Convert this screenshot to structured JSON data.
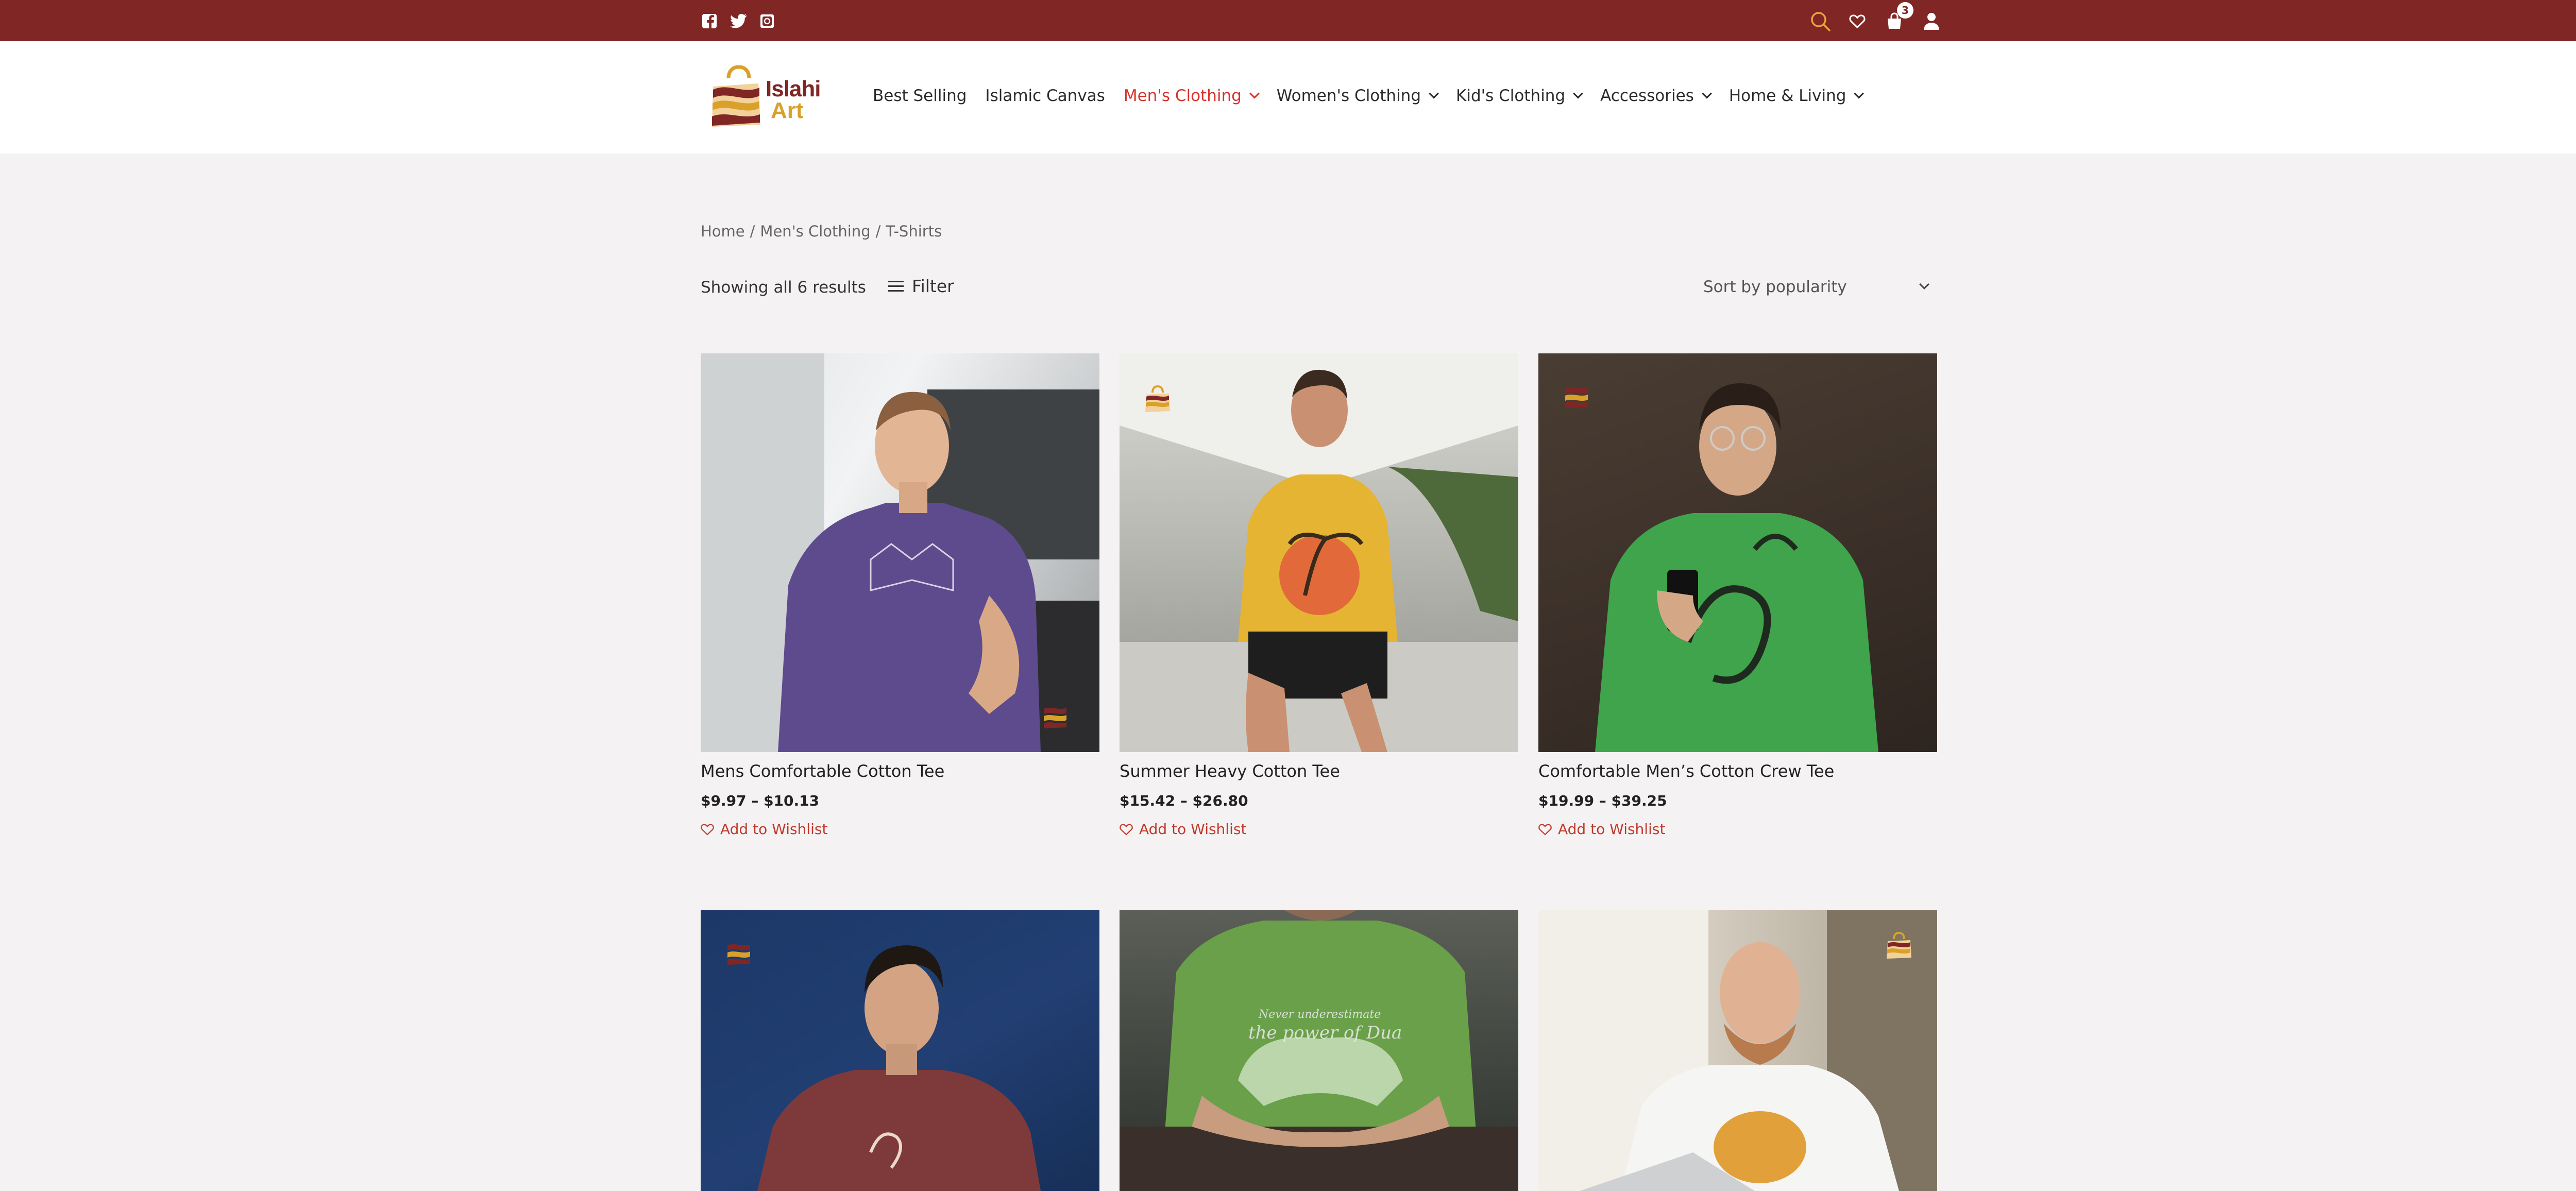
{
  "topbar": {
    "social": [
      "facebook-icon",
      "twitter-icon",
      "instagram-icon"
    ],
    "icons": [
      "search-icon",
      "heart-icon",
      "cart-icon",
      "user-icon"
    ],
    "cart_count": "3",
    "bg_color": "#802624"
  },
  "logo": {
    "line1": "Islahi",
    "line2": "Art"
  },
  "nav": [
    {
      "label": "Best Selling",
      "dropdown": false
    },
    {
      "label": "Islamic Canvas",
      "dropdown": false
    },
    {
      "label": "Men's Clothing",
      "dropdown": true,
      "active": true
    },
    {
      "label": "Women's Clothing",
      "dropdown": true
    },
    {
      "label": "Kid's Clothing",
      "dropdown": true
    },
    {
      "label": "Accessories",
      "dropdown": true
    },
    {
      "label": "Home & Living",
      "dropdown": true
    }
  ],
  "breadcrumb": {
    "home": "Home",
    "sep1": "/",
    "category": "Men's Clothing",
    "sep2": "/",
    "current": "T-Shirts"
  },
  "toolbar": {
    "results": "Showing all 6 results",
    "filter": "Filter",
    "sort": "Sort by popularity"
  },
  "products": [
    {
      "title": "Mens Comfortable Cotton Tee",
      "price": "$9.97 – $10.13",
      "wishlist": "Add to Wishlist"
    },
    {
      "title": "Summer Heavy Cotton Tee",
      "price": "$15.42 – $26.80",
      "wishlist": "Add to Wishlist"
    },
    {
      "title": "Comfortable Men’s Cotton Crew Tee",
      "price": "$19.99 – $39.25",
      "wishlist": "Add to Wishlist"
    },
    {
      "title": "",
      "price": "",
      "wishlist": ""
    },
    {
      "title": "",
      "price": "",
      "wishlist": ""
    },
    {
      "title": "",
      "price": "",
      "wishlist": ""
    }
  ],
  "shirt_prints": {
    "p5_line1": "Never underestimate",
    "p5_line2": "the power of Dua"
  },
  "colors": {
    "accent": "#d8322b",
    "brand": "#802624",
    "logo_gold": "#d9a12a"
  }
}
